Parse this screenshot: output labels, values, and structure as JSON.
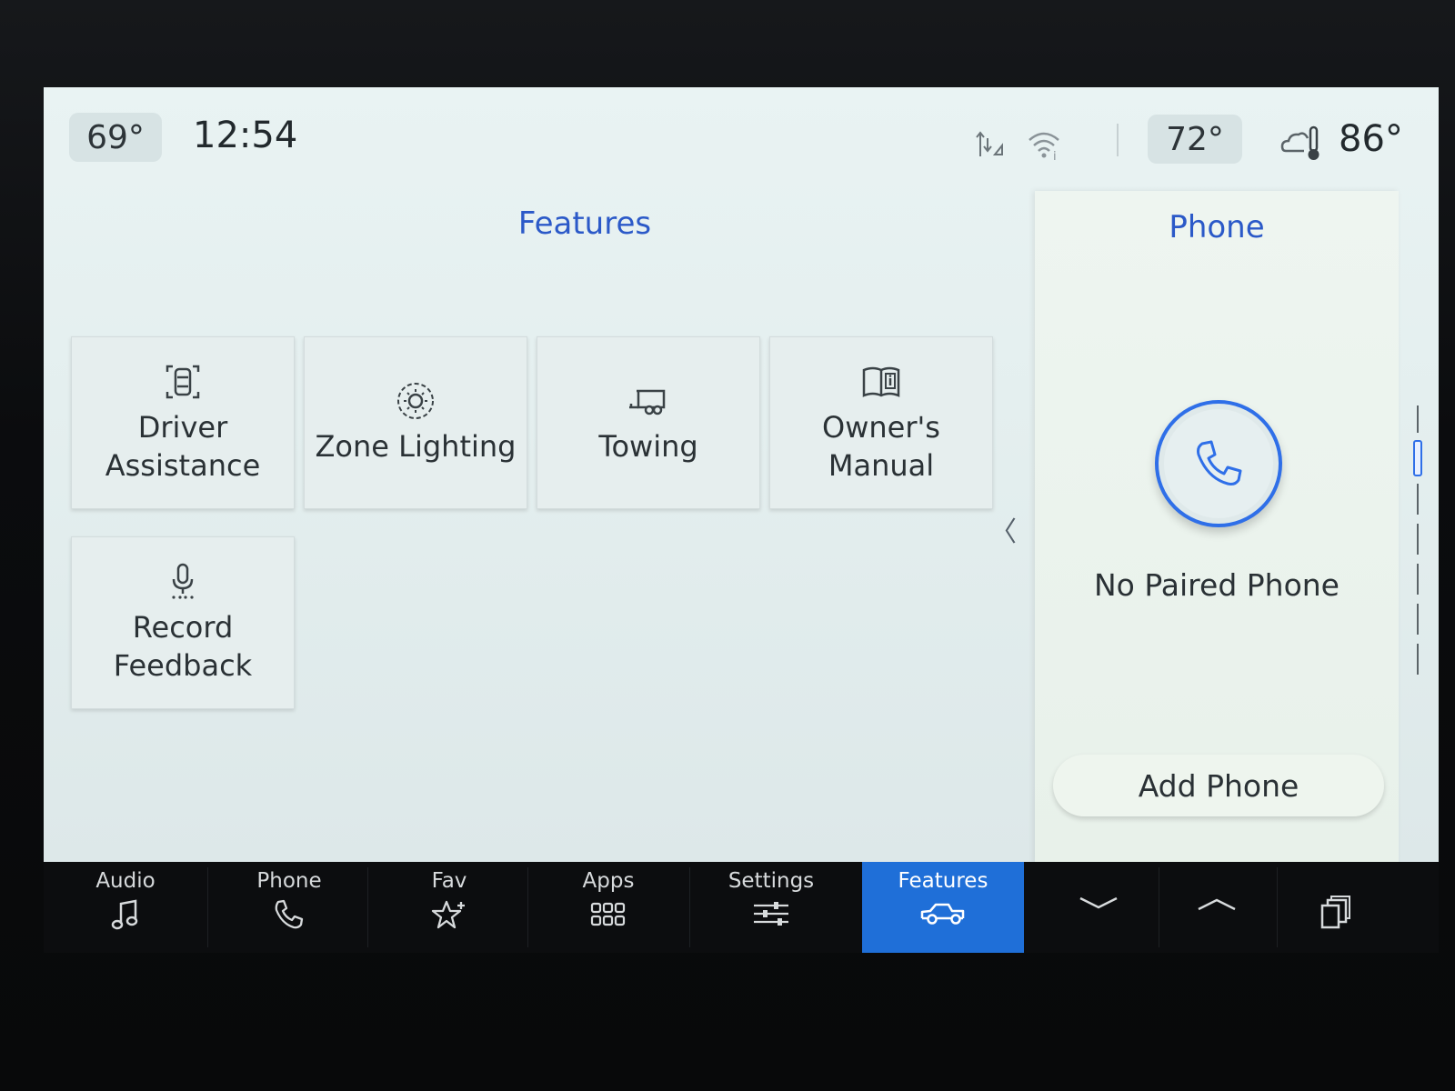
{
  "status_bar": {
    "outside_temp": "69°",
    "clock": "12:54",
    "cabin_temp": "72°",
    "high_temp": "86°",
    "icons": [
      "signal-arrows-icon",
      "wifi-icon",
      "weather-cloud-thermometer-icon"
    ]
  },
  "features": {
    "title": "Features",
    "tiles": [
      {
        "label": "Driver\nAssistance",
        "icon": "driver-assistance-icon"
      },
      {
        "label": "Zone Lighting",
        "icon": "zone-lighting-icon"
      },
      {
        "label": "Towing",
        "icon": "trailer-icon"
      },
      {
        "label": "Owner's\nManual",
        "icon": "manual-book-icon"
      },
      {
        "label": "Record\nFeedback",
        "icon": "microphone-icon"
      }
    ],
    "collapse_glyph": "〈"
  },
  "phone_panel": {
    "title": "Phone",
    "status": "No Paired Phone",
    "add_button": "Add Phone",
    "icon": "phone-handset-icon"
  },
  "nav": {
    "items": [
      {
        "label": "Audio",
        "icon": "music-note-icon"
      },
      {
        "label": "Phone",
        "icon": "phone-icon"
      },
      {
        "label": "Fav",
        "icon": "star-plus-icon"
      },
      {
        "label": "Apps",
        "icon": "apps-grid-icon"
      },
      {
        "label": "Settings",
        "icon": "sliders-icon"
      },
      {
        "label": "Features",
        "icon": "truck-icon",
        "active": true
      }
    ],
    "extra_icons": [
      "chevron-down-icon",
      "chevron-up-icon",
      "copy-windows-icon"
    ]
  },
  "colors": {
    "accent_blue": "#2b59c8",
    "nav_active": "#1f6fd8",
    "screen_bg": "#e5efef"
  }
}
